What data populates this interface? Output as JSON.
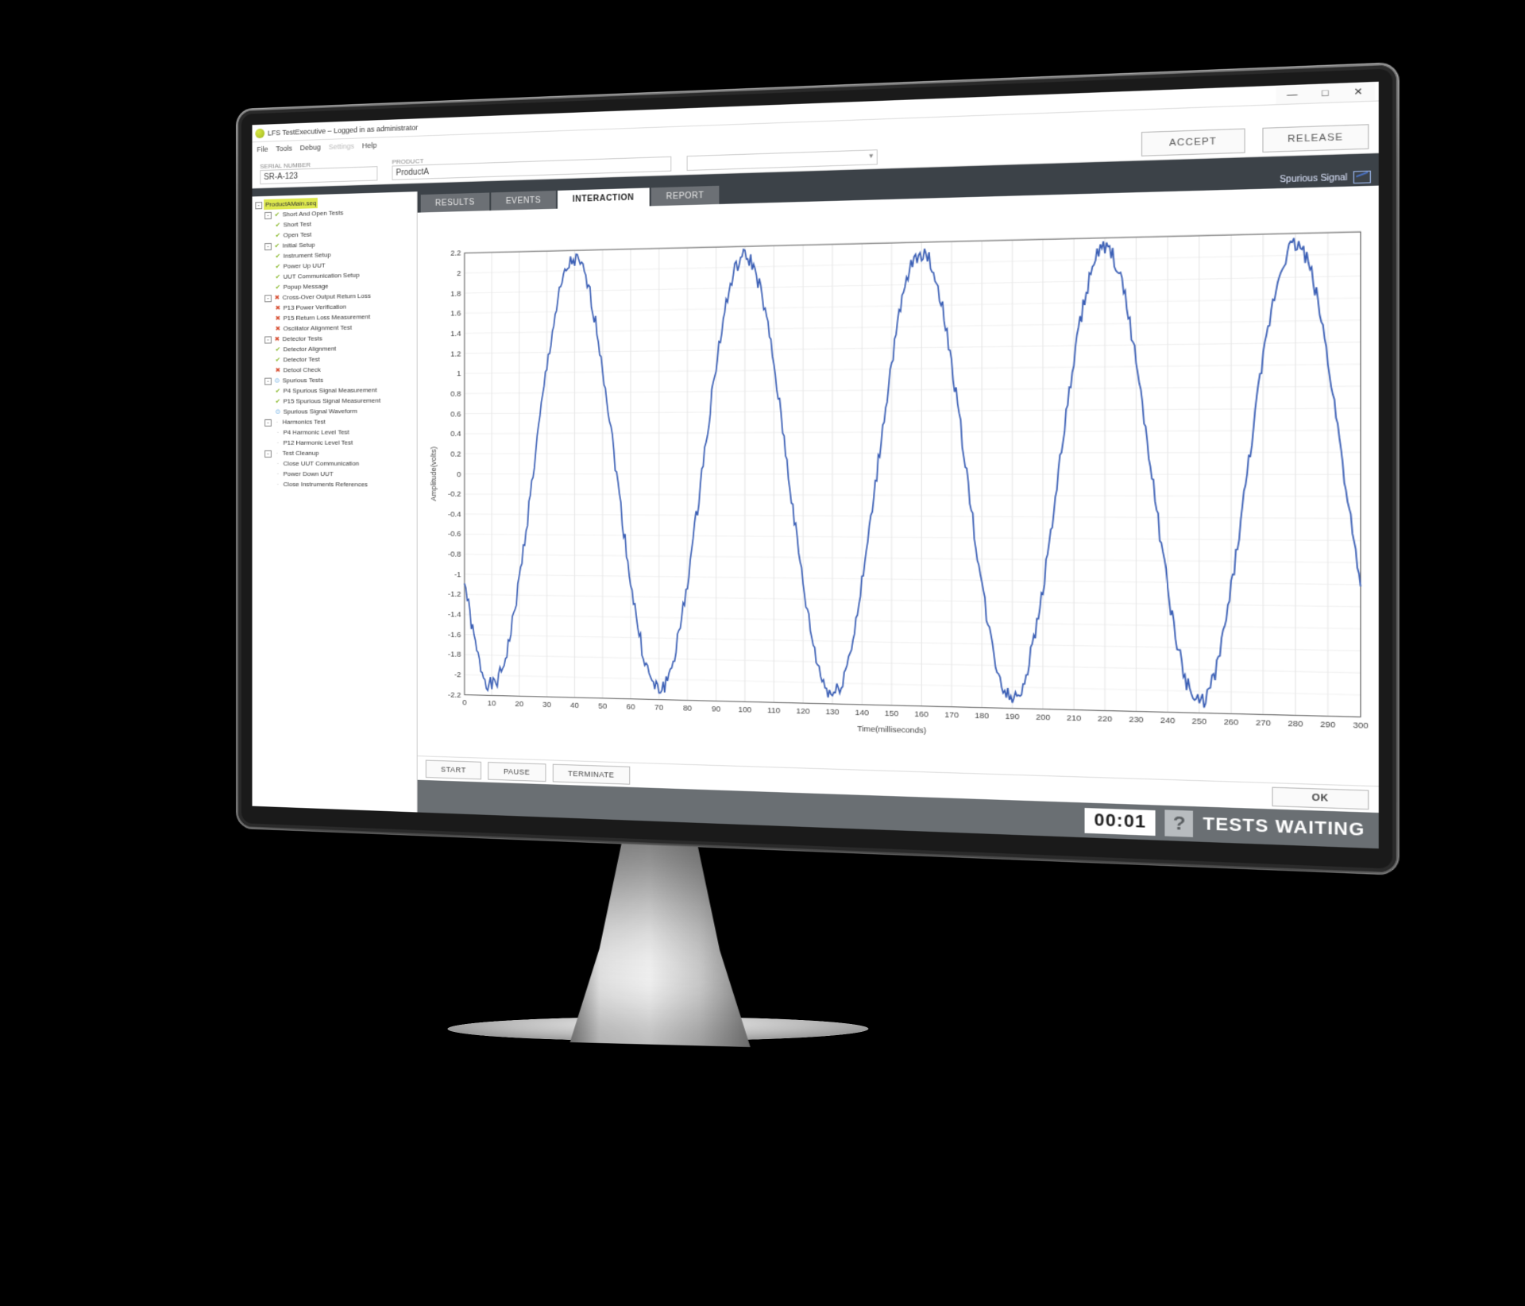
{
  "window": {
    "title": "LFS TestExecutive – Logged in as administrator",
    "minimize": "—",
    "maximize": "□",
    "close": "✕"
  },
  "menu": [
    "File",
    "Tools",
    "Debug",
    "Settings",
    "Help"
  ],
  "menu_disabled_index": 3,
  "form": {
    "serial_label": "SERIAL NUMBER",
    "serial_value": "SR-A-123",
    "product_label": "PRODUCT",
    "product_value": "ProductA",
    "accept": "ACCEPT",
    "release": "RELEASE"
  },
  "tabs": [
    "RESULTS",
    "EVENTS",
    "INTERACTION",
    "REPORT"
  ],
  "active_tab": 2,
  "chart_label": "Spurious Signal",
  "tree": [
    {
      "exp": "-",
      "icon": "root",
      "label": "ProductAMain.seq",
      "children": [
        {
          "exp": "-",
          "icon": "pass",
          "label": "Short And Open Tests",
          "children": [
            {
              "icon": "pass",
              "label": "Short Test"
            },
            {
              "icon": "pass",
              "label": "Open Test"
            }
          ]
        },
        {
          "exp": "-",
          "icon": "pass",
          "label": "Initial Setup",
          "children": [
            {
              "icon": "pass",
              "label": "Instrument Setup"
            },
            {
              "icon": "pass",
              "label": "Power Up UUT"
            },
            {
              "icon": "pass",
              "label": "UUT Communication Setup"
            },
            {
              "icon": "pass",
              "label": "Popup Message"
            }
          ]
        },
        {
          "exp": "-",
          "icon": "fail",
          "label": "Cross-Over Output Return Loss",
          "children": [
            {
              "icon": "fail",
              "label": "P13 Power Verification"
            },
            {
              "icon": "fail",
              "label": "P15 Return Loss Measurement"
            },
            {
              "icon": "fail",
              "label": "Oscillator Alignment Test"
            }
          ]
        },
        {
          "exp": "-",
          "icon": "fail",
          "label": "Detector Tests",
          "children": [
            {
              "icon": "pass",
              "label": "Detector Alignment"
            },
            {
              "icon": "pass",
              "label": "Detector Test"
            },
            {
              "icon": "fail",
              "label": "Detool Check"
            }
          ]
        },
        {
          "exp": "-",
          "icon": "run",
          "label": "Spurious Tests",
          "children": [
            {
              "icon": "pass",
              "label": "P4 Spurious Signal Measurement"
            },
            {
              "icon": "pass",
              "label": "P15 Spurious Signal Measurement"
            },
            {
              "icon": "run",
              "label": "Spurious Signal Waveform"
            }
          ]
        },
        {
          "exp": "-",
          "icon": "none",
          "label": "Harmonics Test",
          "children": [
            {
              "icon": "none",
              "label": "P4 Harmonic Level Test"
            },
            {
              "icon": "none",
              "label": "P12 Harmonic Level Test"
            }
          ]
        },
        {
          "exp": "-",
          "icon": "none",
          "label": "Test Cleanup",
          "children": [
            {
              "icon": "none",
              "label": "Close UUT Communication"
            },
            {
              "icon": "none",
              "label": "Power Down UUT"
            },
            {
              "icon": "none",
              "label": "Close Instruments References"
            }
          ]
        }
      ]
    }
  ],
  "controls": {
    "start": "START",
    "pause": "PAUSE",
    "terminate": "TERMINATE",
    "ok": "OK"
  },
  "status": {
    "time": "00:01",
    "question": "?",
    "msg": "TESTS WAITING"
  },
  "chart_data": {
    "type": "line",
    "title": "Spurious Signal",
    "xlabel": "Time(milliseconds)",
    "ylabel": "Amplitude(volts)",
    "xlim": [
      0,
      300
    ],
    "ylim": [
      -2.2,
      2.2
    ],
    "x_ticks": [
      0,
      10,
      20,
      30,
      40,
      50,
      60,
      70,
      80,
      90,
      100,
      110,
      120,
      130,
      140,
      150,
      160,
      170,
      180,
      190,
      200,
      210,
      220,
      230,
      240,
      250,
      260,
      270,
      280,
      290,
      300
    ],
    "y_ticks": [
      -2.2,
      -2.0,
      -1.8,
      -1.6,
      -1.4,
      -1.2,
      -1.0,
      -0.8,
      -0.6,
      -0.4,
      -0.2,
      0,
      0.2,
      0.4,
      0.6,
      0.8,
      1.0,
      1.2,
      1.4,
      1.6,
      1.8,
      2.0,
      2.2
    ],
    "series": [
      {
        "name": "Spurious Signal",
        "period_ms": 60,
        "amplitude": 2.1,
        "phase_anchor": {
          "x": 40,
          "value": 2.1
        }
      }
    ],
    "noise": 0.08
  }
}
